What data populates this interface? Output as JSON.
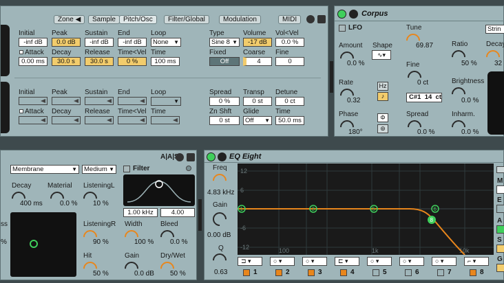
{
  "tabs": {
    "zone": "Zone ◀",
    "sample": "Sample",
    "pitch_osc": "Pitch/Osc",
    "filter_global": "Filter/Global",
    "modulation": "Modulation",
    "midi": "MIDI"
  },
  "env1": {
    "initial_label": "Initial",
    "initial": "-inf dB",
    "peak_label": "Peak",
    "peak": "0.0 dB",
    "sustain_label": "Sustain",
    "sustain": "-inf dB",
    "end_label": "End",
    "end": "-inf dB",
    "loop_label": "Loop",
    "loop": "None",
    "attack_label": "Attack",
    "attack": "0.00 ms",
    "decay_label": "Decay",
    "decay": "30.0 s",
    "release_label": "Release",
    "release": "30.0 s",
    "timevel_label": "Time<Vel",
    "timevel": "0 %",
    "time_label": "Time",
    "time": "100 ms"
  },
  "osc": {
    "type_label": "Type",
    "type": "Sine 8",
    "volume_label": "Volume",
    "volume": "-17 dB",
    "volvel_label": "Vol<Vel",
    "volvel": "0.0 %",
    "fixed_label": "Fixed",
    "fixed": "Off",
    "coarse_label": "Coarse",
    "coarse": "4",
    "fine_label": "Fine",
    "fine": "0"
  },
  "env2": {
    "initial_label": "Initial",
    "peak_label": "Peak",
    "sustain_label": "Sustain",
    "end_label": "End",
    "loop_label": "Loop",
    "attack_label": "Attack",
    "decay_label": "Decay",
    "release_label": "Release",
    "timevel_label": "Time<Vel",
    "time_label": "Time"
  },
  "osc2": {
    "spread_label": "Spread",
    "spread": "0 %",
    "transp_label": "Transp",
    "transp": "0 st",
    "detune_label": "Detune",
    "detune": "0 ct",
    "znshft_label": "Zn Shft",
    "znshft": "0 st",
    "glide_label": "Glide",
    "glide": "Off",
    "time_label": "Time",
    "time": "50.0 ms"
  },
  "corpus": {
    "title": "Corpus",
    "lfo_label": "LFO",
    "amount_label": "Amount",
    "amount": "0.0 %",
    "shape_label": "Shape",
    "rate_label": "Rate",
    "rate": "0.32",
    "hz_label": "Hz",
    "note_label": "♪",
    "phase_label": "Phase",
    "phase": "180°",
    "phi_label": "Φ",
    "tune_label": "Tune",
    "tune": "69.87",
    "fine_label": "Fine",
    "fine": "0 ct",
    "note_readout": "C#1  14  ct",
    "spread_label": "Spread",
    "spread": "0.0 %",
    "ratio_label": "Ratio",
    "ratio": "50 %",
    "brightness_label": "Brightness",
    "brightness": "0.0 %",
    "inharm_label": "Inharm.",
    "inharm": "0.0 %",
    "string_label": "Strin",
    "decay_label": "Decay",
    "decay": "32"
  },
  "resonator": {
    "aas_label": "A|A|S",
    "type": "Membrane",
    "quality": "Medium",
    "filter_label": "Filter",
    "decay_label": "Decay",
    "decay": "400 ms",
    "material_label": "Material",
    "material": "0.0 %",
    "listeningl_label": "ListeningL",
    "listeningl": "10 %",
    "listeningr_label": "ListeningR",
    "listeningr": "90 %",
    "hit_label": "Hit",
    "hit": "50 %",
    "freq": "1.00 kHz",
    "q": "4.00",
    "width_label": "Width",
    "width": "100 %",
    "bleed_label": "Bleed",
    "bleed": "0.0 %",
    "gain_label": "Gain",
    "gain": "0.0 dB",
    "drywet_label": "Dry/Wet",
    "drywet": "50 %",
    "side_label": "ss",
    "side_val": "%"
  },
  "eq": {
    "title": "EQ Eight",
    "freq_label": "Freq",
    "freq": "4.83 kHz",
    "gain_label": "Gain",
    "gain": "0.00 dB",
    "q_label": "Q",
    "q": "0.63",
    "y_ticks": [
      "12",
      "6",
      "0",
      "-6",
      "-12"
    ],
    "x_ticks": [
      "100",
      "1k",
      "10k"
    ],
    "bands": [
      "1",
      "2",
      "3",
      "4",
      "5",
      "6",
      "7",
      "8"
    ],
    "right_labels": [
      "M",
      "S",
      "E",
      "A",
      "S",
      "G"
    ]
  },
  "colors": {
    "panel": "#9fb5b9",
    "accent": "#e8861c",
    "green": "#3fcf5c",
    "yellow": "#f2cc6c"
  }
}
